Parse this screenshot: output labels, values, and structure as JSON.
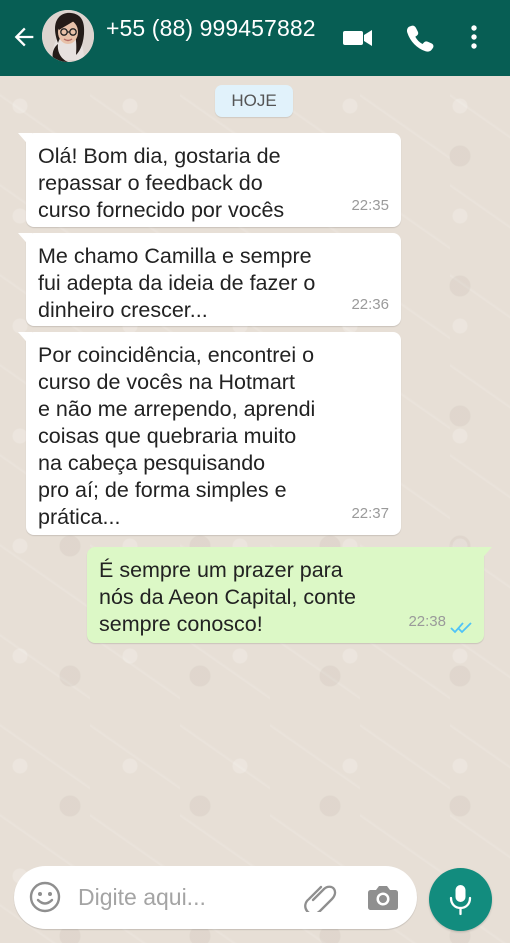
{
  "header": {
    "contact_name": "+55 (88) 999457882",
    "icons": [
      "back-arrow-icon",
      "avatar",
      "video-call-icon",
      "phone-icon",
      "more-vertical-icon"
    ]
  },
  "chat": {
    "date_label": "HOJE",
    "messages": [
      {
        "direction": "incoming",
        "text": "Olá! Bom dia, gostaria de\nrepassar o feedback do\ncurso fornecido por vocês",
        "time": "22:35"
      },
      {
        "direction": "incoming",
        "text": "Me chamo Camilla e sempre\nfui adepta da ideia de fazer o\ndinheiro crescer...",
        "time": "22:36"
      },
      {
        "direction": "incoming",
        "text": "Por coincidência, encontrei o\ncurso de vocês na Hotmart\ne não me arrependo, aprendi\ncoisas que quebraria muito\nna cabeça pesquisando\npro aí; de forma simples e\nprática...",
        "time": "22:37"
      },
      {
        "direction": "outgoing",
        "text": "É sempre um prazer para\nnós da Aeon Capital, conte\nsempre conosco!",
        "time": "22:38",
        "status": "read"
      }
    ]
  },
  "composer": {
    "placeholder": "Digite aqui...",
    "icons": [
      "emoji-icon",
      "attachment-icon",
      "camera-icon",
      "microphone-icon"
    ]
  },
  "colors": {
    "header": "#075e54",
    "incoming_bubble": "#ffffff",
    "outgoing_bubble": "#dcf8c6",
    "accent": "#128c7e",
    "read_ticks": "#4fc3f7"
  }
}
